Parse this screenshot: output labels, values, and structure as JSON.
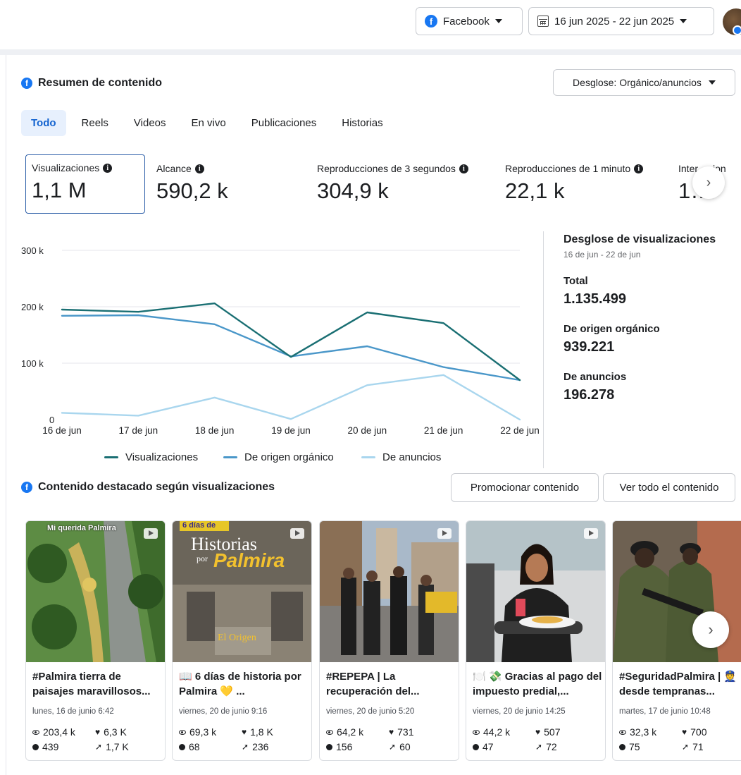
{
  "header": {
    "platform_label": "Facebook",
    "date_range_label": "16 jun 2025 - 22 jun 2025"
  },
  "summary": {
    "title": "Resumen de contenido",
    "breakdown_button": "Desglose: Orgánico/anuncios",
    "tabs": [
      {
        "label": "Todo",
        "active": true
      },
      {
        "label": "Reels",
        "active": false
      },
      {
        "label": "Videos",
        "active": false
      },
      {
        "label": "En vivo",
        "active": false
      },
      {
        "label": "Publicaciones",
        "active": false
      },
      {
        "label": "Historias",
        "active": false
      }
    ],
    "metrics": [
      {
        "label": "Visualizaciones",
        "value": "1,1 M"
      },
      {
        "label": "Alcance",
        "value": "590,2 k"
      },
      {
        "label": "Reproducciones de 3 segundos",
        "value": "304,9 k"
      },
      {
        "label": "Reproducciones de 1 minuto",
        "value": "22,1 k"
      },
      {
        "label": "Inter…cion",
        "value": "1…"
      }
    ]
  },
  "chart_data": {
    "type": "line",
    "x": [
      "16 de jun",
      "17 de jun",
      "18 de jun",
      "19 de jun",
      "20 de jun",
      "21 de jun",
      "22 de jun"
    ],
    "y_ticks": [
      "0",
      "100 k",
      "200 k",
      "300 k"
    ],
    "ylim": [
      0,
      300000
    ],
    "grid": true,
    "legend_position": "bottom",
    "series": [
      {
        "name": "Visualizaciones",
        "color": "#1a6f73",
        "values": [
          195000,
          191000,
          206000,
          111000,
          190000,
          171000,
          70000
        ]
      },
      {
        "name": "De origen orgánico",
        "color": "#4a97c9",
        "values": [
          184000,
          185000,
          169000,
          112000,
          130000,
          93000,
          70000
        ]
      },
      {
        "name": "De anuncios",
        "color": "#a9d6ee",
        "values": [
          12000,
          7000,
          39000,
          1000,
          61000,
          79000,
          0
        ]
      }
    ]
  },
  "views_breakdown": {
    "title": "Desglose de visualizaciones",
    "subtitle": "16 de jun - 22 de jun",
    "total_label": "Total",
    "total_value": "1.135.499",
    "organic_label": "De origen orgánico",
    "organic_value": "939.221",
    "ads_label": "De anuncios",
    "ads_value": "196.278"
  },
  "featured": {
    "title": "Contenido destacado según visualizaciones",
    "promote_button": "Promocionar contenido",
    "view_all_button": "Ver todo el contenido",
    "posts": [
      {
        "title": "#Palmira tierra de paisajes maravillosos...",
        "date": "lunes, 16 de junio 6:42",
        "views": "203,4 k",
        "reactions": "6,3 K",
        "comments": "439",
        "shares": "1,7 K",
        "overlay": "Mi querida Palmira"
      },
      {
        "title": "📖 6 días de historia por Palmira 💛 ...",
        "date": "viernes, 20 de junio 9:16",
        "views": "69,3 k",
        "reactions": "1,8 K",
        "comments": "68",
        "shares": "236",
        "overlay_top": "6 días de",
        "overlay_mid": "Historias",
        "overlay_small": "por",
        "overlay_big": "Palmira",
        "overlay_bottom": "El Origen"
      },
      {
        "title": "#REPEPA | La recuperación del...",
        "date": "viernes, 20 de junio 5:20",
        "views": "64,2 k",
        "reactions": "731",
        "comments": "156",
        "shares": "60"
      },
      {
        "title": "🍽️ 💸 Gracias al pago del impuesto predial,...",
        "date": "viernes, 20 de junio 14:25",
        "views": "44,2 k",
        "reactions": "507",
        "comments": "47",
        "shares": "72"
      },
      {
        "title": "#SeguridadPalmira | 👮 desde tempranas...",
        "date": "martes, 17 de junio 10:48",
        "views": "32,3 k",
        "reactions": "700",
        "comments": "75",
        "shares": "71"
      }
    ]
  }
}
